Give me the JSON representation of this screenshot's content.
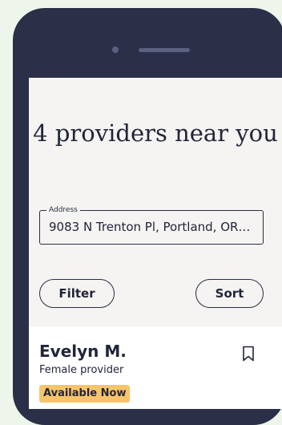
{
  "header": {
    "title": "4 providers near you"
  },
  "address": {
    "label": "Address",
    "value": "9083 N Trenton Pl, Portland, OR…"
  },
  "controls": {
    "filter_label": "Filter",
    "sort_label": "Sort"
  },
  "provider": {
    "name": "Evelyn M.",
    "gender": "Female provider",
    "availability": "Available Now"
  },
  "colors": {
    "background": "#eef6ec",
    "phone_frame": "#2b2f48",
    "screen": "#f5f4f2",
    "card": "#ffffff",
    "badge": "#f6c46b",
    "text": "#22253a"
  },
  "icons": {
    "save": "bookmark-icon"
  }
}
